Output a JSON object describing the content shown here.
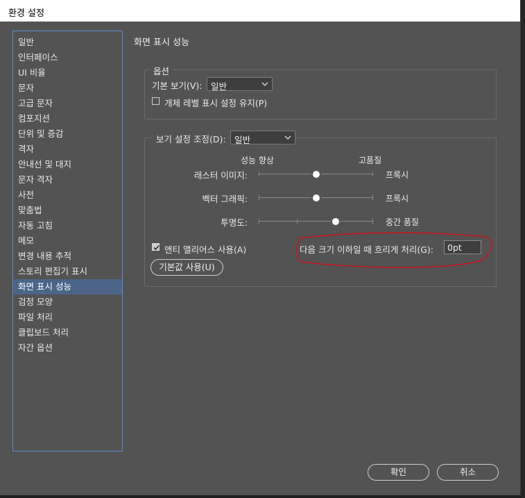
{
  "window": {
    "title": "환경 설정"
  },
  "sidebar": {
    "items": [
      {
        "label": "일반"
      },
      {
        "label": "인터페이스"
      },
      {
        "label": "UI 비율"
      },
      {
        "label": "문자"
      },
      {
        "label": "고급 문자"
      },
      {
        "label": "컴포지션"
      },
      {
        "label": "단위 및 증감"
      },
      {
        "label": "격자"
      },
      {
        "label": "안내선 및 대지"
      },
      {
        "label": "문자 격자"
      },
      {
        "label": "사전"
      },
      {
        "label": "맞춤법"
      },
      {
        "label": "자동 고침"
      },
      {
        "label": "메모"
      },
      {
        "label": "변경 내용 추적"
      },
      {
        "label": "스토리 편집기 표시"
      },
      {
        "label": "화면 표시 성능",
        "active": true
      },
      {
        "label": "검정 모양"
      },
      {
        "label": "파일 처리"
      },
      {
        "label": "클립보드 처리"
      },
      {
        "label": "자간 옵션"
      }
    ]
  },
  "panel": {
    "title": "화면 표시 성능",
    "options": {
      "legend": "옵션",
      "default_view_label": "기본 보기(V):",
      "default_view_value": "일반",
      "preserve_object_label": "개체 레벨 표시 설정 유지(P)",
      "preserve_object_checked": false
    },
    "adjust": {
      "label": "보기 설정 조정(D):",
      "value": "일반",
      "col_left": "성능 향상",
      "col_right": "고품질",
      "sliders": [
        {
          "label": "래스터 이미지:",
          "value_text": "프록시",
          "position": 0.5
        },
        {
          "label": "벡터 그래픽:",
          "value_text": "프록시",
          "position": 0.5
        },
        {
          "label": "투명도:",
          "value_text": "중간 품질",
          "position": 0.67
        }
      ],
      "antialias_label": "앤티 앨리어스 사용(A)",
      "antialias_checked": true,
      "greek_label": "다음 크기 이하일 때 흐리게 처리(G):",
      "greek_value": "0pt",
      "defaults_button": "기본값 사용(U)"
    }
  },
  "footer": {
    "ok_label": "확인",
    "cancel_label": "취소"
  },
  "colors": {
    "background": "#535353",
    "selection": "#4b6488",
    "annotation": "#c8161d"
  }
}
